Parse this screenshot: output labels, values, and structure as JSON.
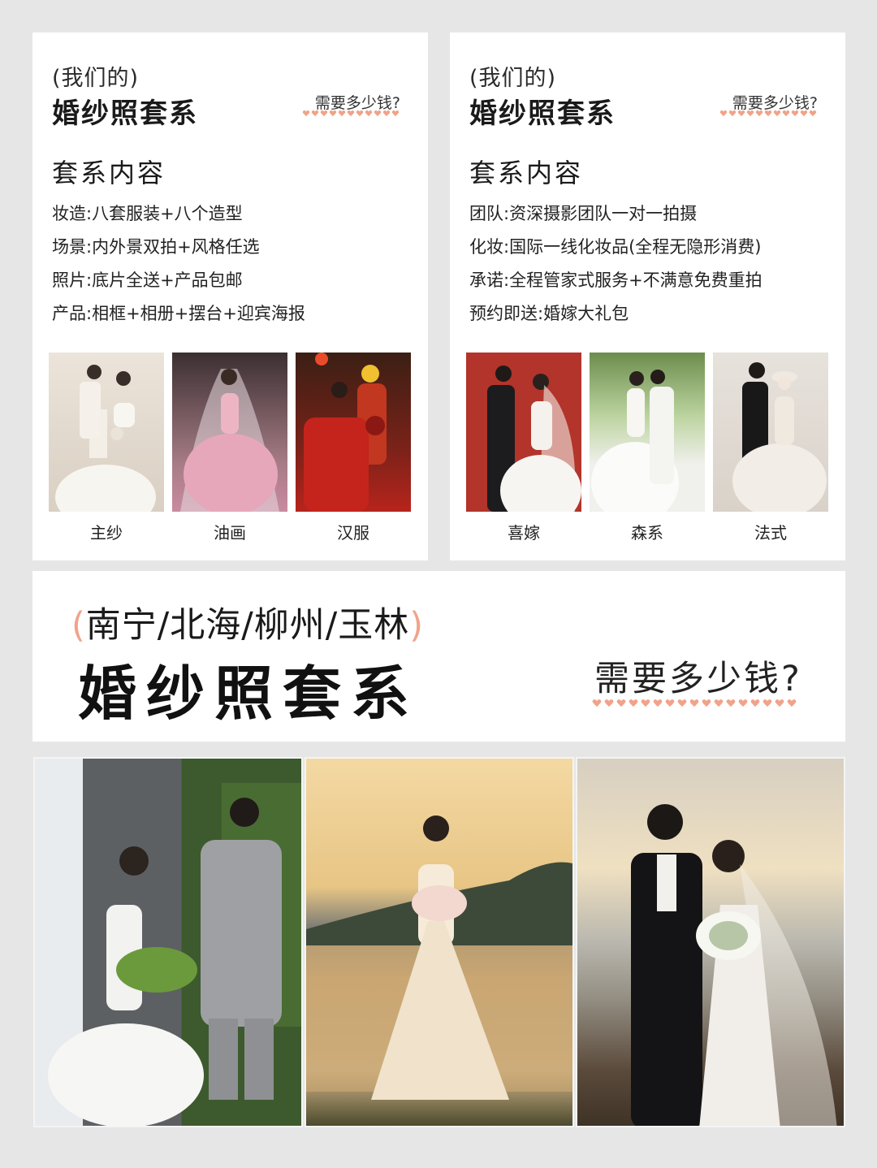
{
  "cards": [
    {
      "paren_title": "(我们的)",
      "title": "婚纱照套系",
      "price_question": "需要多少钱?",
      "section_title": "套系内容",
      "features": [
        "妆造:八套服装+八个造型",
        "场景:内外景双拍+风格任选",
        "照片:底片全送+产品包邮",
        "产品:相框+相册+摆台+迎宾海报"
      ],
      "photos": [
        {
          "caption": "主纱"
        },
        {
          "caption": "油画"
        },
        {
          "caption": "汉服"
        }
      ]
    },
    {
      "paren_title": "(我们的)",
      "title": "婚纱照套系",
      "price_question": "需要多少钱?",
      "section_title": "套系内容",
      "features": [
        "团队:资深摄影团队一对一拍摄",
        "化妆:国际一线化妆品(全程无隐形消费)",
        "承诺:全程管家式服务+不满意免费重拍",
        "预约即送:婚嫁大礼包"
      ],
      "photos": [
        {
          "caption": "喜嫁"
        },
        {
          "caption": "森系"
        },
        {
          "caption": "法式"
        }
      ]
    }
  ],
  "banner": {
    "paren_open": "(",
    "cities": "南宁/北海/柳州/玉林",
    "paren_close": ")",
    "title": "婚纱照套系",
    "price_question": "需要多少钱?"
  },
  "colors": {
    "accent": "#f0a38a",
    "background": "#e6e6e6",
    "card": "#ffffff"
  }
}
